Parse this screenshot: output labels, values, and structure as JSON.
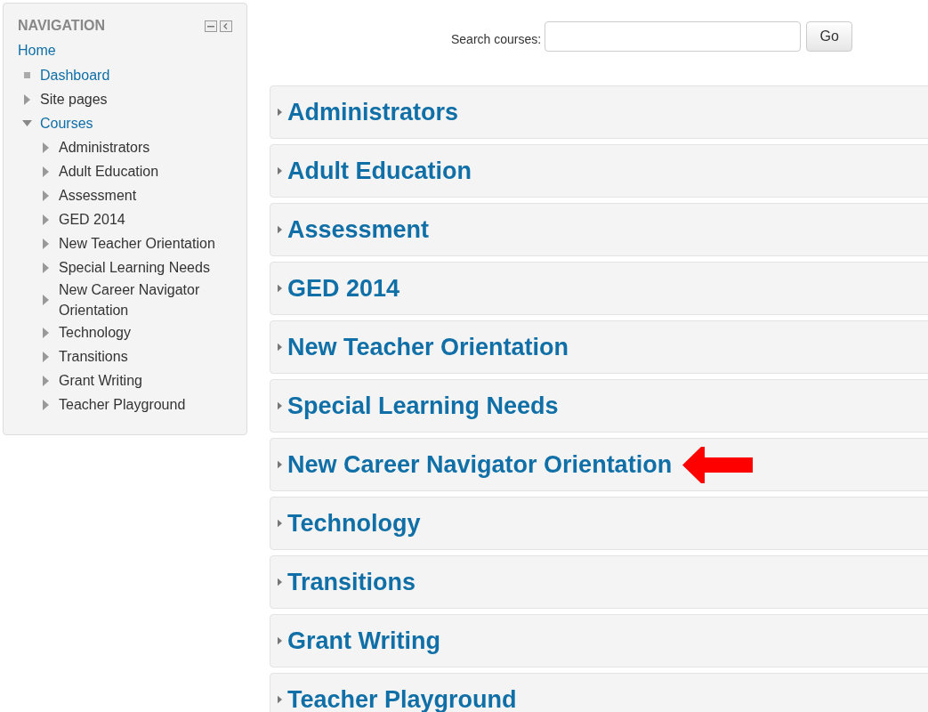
{
  "navigation": {
    "title": "NAVIGATION",
    "home": "Home",
    "items": [
      {
        "label": "Dashboard",
        "kind": "leaf",
        "link": true
      },
      {
        "label": "Site pages",
        "kind": "branch",
        "link": false,
        "expanded": false
      },
      {
        "label": "Courses",
        "kind": "branch",
        "link": true,
        "expanded": true,
        "children": [
          {
            "label": "Administrators",
            "kind": "branch",
            "link": false,
            "expanded": false
          },
          {
            "label": "Adult Education",
            "kind": "branch",
            "link": false,
            "expanded": false
          },
          {
            "label": "Assessment",
            "kind": "branch",
            "link": false,
            "expanded": false
          },
          {
            "label": "GED 2014",
            "kind": "branch",
            "link": false,
            "expanded": false
          },
          {
            "label": "New Teacher Orientation",
            "kind": "branch",
            "link": false,
            "expanded": false
          },
          {
            "label": "Special Learning Needs",
            "kind": "branch",
            "link": false,
            "expanded": false
          },
          {
            "label": "New Career Navigator Orientation",
            "kind": "branch",
            "link": false,
            "expanded": false
          },
          {
            "label": "Technology",
            "kind": "branch",
            "link": false,
            "expanded": false
          },
          {
            "label": "Transitions",
            "kind": "branch",
            "link": false,
            "expanded": false
          },
          {
            "label": "Grant Writing",
            "kind": "branch",
            "link": false,
            "expanded": false
          },
          {
            "label": "Teacher Playground",
            "kind": "branch",
            "link": false,
            "expanded": false
          }
        ]
      }
    ]
  },
  "search": {
    "label": "Search courses:",
    "button": "Go"
  },
  "courses": [
    {
      "title": "Administrators",
      "highlighted": false
    },
    {
      "title": "Adult Education",
      "highlighted": false
    },
    {
      "title": "Assessment",
      "highlighted": false
    },
    {
      "title": "GED 2014",
      "highlighted": false
    },
    {
      "title": "New Teacher Orientation",
      "highlighted": false
    },
    {
      "title": "Special Learning Needs",
      "highlighted": false
    },
    {
      "title": "New Career Navigator Orientation",
      "highlighted": true
    },
    {
      "title": "Technology",
      "highlighted": false
    },
    {
      "title": "Transitions",
      "highlighted": false
    },
    {
      "title": "Grant Writing",
      "highlighted": false
    },
    {
      "title": "Teacher Playground",
      "highlighted": false
    }
  ]
}
